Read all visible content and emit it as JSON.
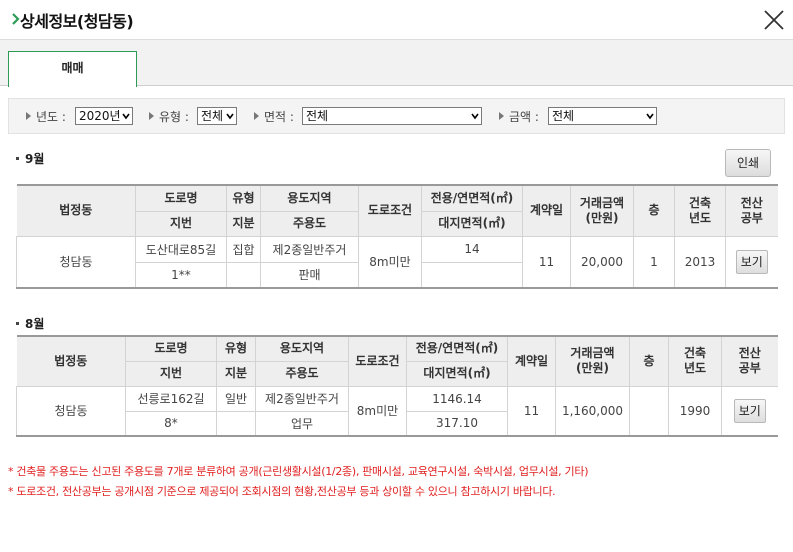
{
  "title": "상세정보(청담동)",
  "colors": {
    "accent": "#2c9b55",
    "note": "#e02020",
    "header_bg": "#eeeeee"
  },
  "icons": {
    "chevron": "chevron-right-icon",
    "close": "close-icon",
    "filter_arrow": "triangle-right-icon",
    "caret": "caret-down-icon"
  },
  "tabs": [
    {
      "label": "매매",
      "active": true
    }
  ],
  "filters": {
    "year": {
      "label": "년도 :",
      "value": "2020년"
    },
    "type": {
      "label": "유형 :",
      "value": "전체"
    },
    "area": {
      "label": "면적 :",
      "value": "전체"
    },
    "amount": {
      "label": "금액 :",
      "value": "전체"
    }
  },
  "print_label": "인쇄",
  "columns": {
    "dong": "법정동",
    "road": "도로명",
    "jibun": "지번",
    "type": "유형",
    "share": "지분",
    "zone": "용도지역",
    "use": "주용도",
    "road_cond": "도로조건",
    "area": "전용/연면적(㎡)",
    "land_area": "대지면적(㎡)",
    "contract_day": "계약일",
    "price": "거래금액\n(만원)",
    "floor": "층",
    "built": "건축\n년도",
    "doc": "전산\n공부"
  },
  "sections": [
    {
      "month": "9월",
      "row": {
        "dong": "청담동",
        "road": "도산대로85길",
        "jibun": "1**",
        "type": "집합",
        "share": "",
        "zone": "제2종일반주거",
        "use": "판매",
        "road_cond": "8m미만",
        "area": "14",
        "land_area": "",
        "contract_day": "11",
        "price": "20,000",
        "floor": "1",
        "built": "2013",
        "doc_button": "보기"
      }
    },
    {
      "month": "8월",
      "row": {
        "dong": "청담동",
        "road": "선릉로162길",
        "jibun": "8*",
        "type": "일반",
        "share": "",
        "zone": "제2종일반주거",
        "use": "업무",
        "road_cond": "8m미만",
        "area": "1146.14",
        "land_area": "317.10",
        "contract_day": "11",
        "price": "1,160,000",
        "floor": "",
        "built": "1990",
        "doc_button": "보기"
      }
    }
  ],
  "notes": [
    "* 건축물 주용도는 신고된 주용도를 7개로 분류하여 공개(근린생활시설(1/2종), 판매시설, 교육연구시설, 숙박시설, 업무시설, 기타)",
    "* 도로조건, 전산공부는 공개시점 기준으로 제공되어 조회시점의 현황,전산공부 등과 상이할 수 있으니 참고하시기 바랍니다."
  ]
}
